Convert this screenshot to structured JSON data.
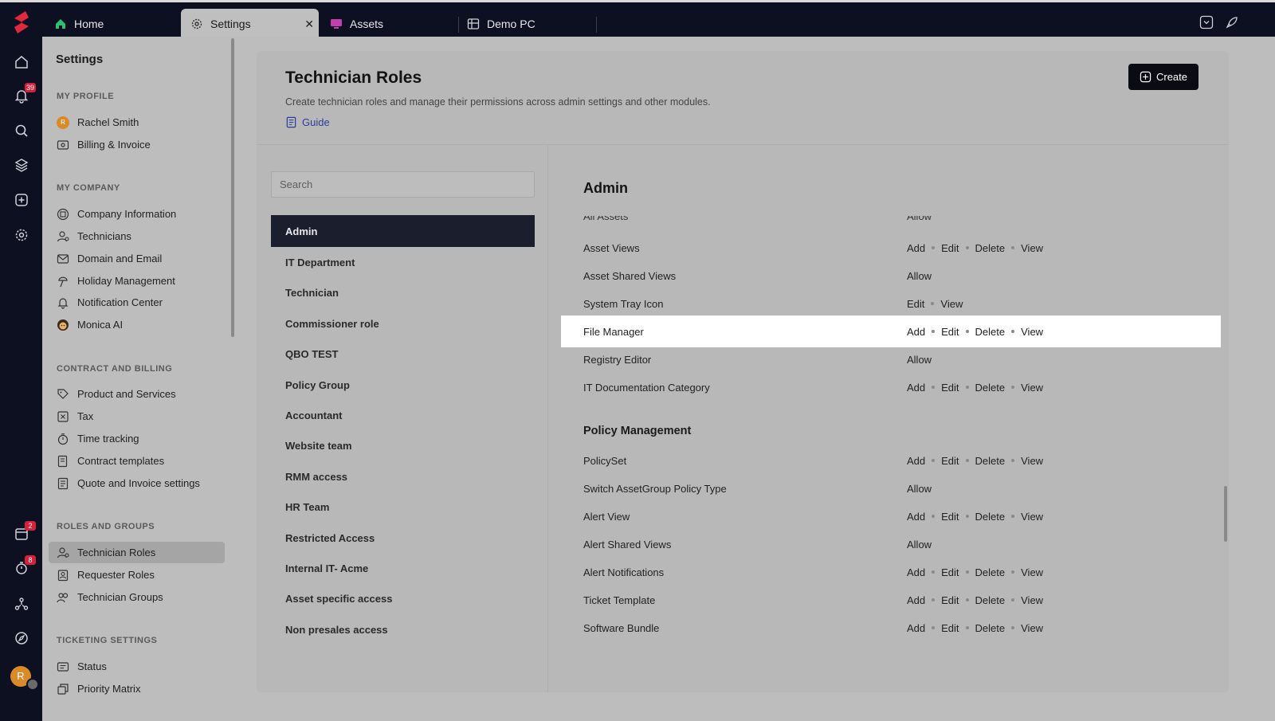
{
  "tabs": [
    {
      "label": "Home",
      "icon": "home-icon"
    },
    {
      "label": "Settings",
      "icon": "gear-icon",
      "active": true
    },
    {
      "label": "Assets",
      "icon": "monitor-icon"
    },
    {
      "label": "Demo PC",
      "icon": "windows-icon"
    }
  ],
  "rail": {
    "notifications_badge": "39",
    "calendar_badge": "2",
    "timer_badge": "8",
    "avatar_letter": "R"
  },
  "sidebar": {
    "title": "Settings",
    "sections": [
      {
        "label": "MY PROFILE",
        "items": [
          {
            "label": "Rachel Smith",
            "icon": "avatar-icon",
            "avatar": "R"
          },
          {
            "label": "Billing & Invoice",
            "icon": "billing-icon"
          }
        ]
      },
      {
        "label": "MY COMPANY",
        "items": [
          {
            "label": "Company Information",
            "icon": "company-icon"
          },
          {
            "label": "Technicians",
            "icon": "technician-icon"
          },
          {
            "label": "Domain and Email",
            "icon": "mail-icon"
          },
          {
            "label": "Holiday Management",
            "icon": "holiday-icon"
          },
          {
            "label": "Notification Center",
            "icon": "bell-icon"
          },
          {
            "label": "Monica AI",
            "icon": "monica-icon"
          }
        ]
      },
      {
        "label": "CONTRACT AND BILLING",
        "items": [
          {
            "label": "Product and Services",
            "icon": "product-icon"
          },
          {
            "label": "Tax",
            "icon": "tax-icon"
          },
          {
            "label": "Time tracking",
            "icon": "timer-icon"
          },
          {
            "label": "Contract templates",
            "icon": "contract-icon"
          },
          {
            "label": "Quote and Invoice settings",
            "icon": "invoice-icon"
          }
        ]
      },
      {
        "label": "ROLES AND GROUPS",
        "items": [
          {
            "label": "Technician Roles",
            "icon": "technician-role-icon",
            "active": true
          },
          {
            "label": "Requester Roles",
            "icon": "requester-icon"
          },
          {
            "label": "Technician Groups",
            "icon": "group-icon"
          }
        ]
      },
      {
        "label": "TICKETING SETTINGS",
        "items": [
          {
            "label": "Status",
            "icon": "status-icon"
          },
          {
            "label": "Priority Matrix",
            "icon": "matrix-icon"
          }
        ]
      }
    ]
  },
  "header": {
    "title": "Technician Roles",
    "description": "Create technician roles and manage their permissions across admin settings and other modules.",
    "guide_label": "Guide",
    "create_label": "Create"
  },
  "roles": {
    "search_placeholder": "Search",
    "items": [
      {
        "label": "Admin",
        "active": true
      },
      {
        "label": "IT Department"
      },
      {
        "label": "Technician"
      },
      {
        "label": "Commissioner role"
      },
      {
        "label": "QBO TEST"
      },
      {
        "label": "Policy Group"
      },
      {
        "label": "Accountant"
      },
      {
        "label": "Website team"
      },
      {
        "label": "RMM access"
      },
      {
        "label": "HR Team"
      },
      {
        "label": "Restricted Access"
      },
      {
        "label": "Internal IT- Acme"
      },
      {
        "label": "Asset specific access"
      },
      {
        "label": "Non presales access"
      }
    ]
  },
  "permissions": {
    "heading": "Admin",
    "cut_row": {
      "name": "All Assets",
      "value": "Allow"
    },
    "asset_rows": [
      {
        "name": "Asset Views",
        "values": [
          "Add",
          "Edit",
          "Delete",
          "View"
        ]
      },
      {
        "name": "Asset Shared Views",
        "values": [
          "Allow"
        ]
      },
      {
        "name": "System Tray Icon",
        "values": [
          "Edit",
          "View"
        ]
      },
      {
        "name": "File Manager",
        "values": [
          "Add",
          "Edit",
          "Delete",
          "View"
        ],
        "highlight": true
      },
      {
        "name": "Registry Editor",
        "values": [
          "Allow"
        ]
      },
      {
        "name": "IT Documentation Category",
        "values": [
          "Add",
          "Edit",
          "Delete",
          "View"
        ]
      }
    ],
    "group_label": "Policy Management",
    "policy_rows": [
      {
        "name": "PolicySet",
        "values": [
          "Add",
          "Edit",
          "Delete",
          "View"
        ]
      },
      {
        "name": "Switch AssetGroup Policy Type",
        "values": [
          "Allow"
        ]
      },
      {
        "name": "Alert View",
        "values": [
          "Add",
          "Edit",
          "Delete",
          "View"
        ]
      },
      {
        "name": "Alert Shared Views",
        "values": [
          "Allow"
        ]
      },
      {
        "name": "Alert Notifications",
        "values": [
          "Add",
          "Edit",
          "Delete",
          "View"
        ]
      },
      {
        "name": "Ticket Template",
        "values": [
          "Add",
          "Edit",
          "Delete",
          "View"
        ]
      },
      {
        "name": "Software Bundle",
        "values": [
          "Add",
          "Edit",
          "Delete",
          "View"
        ]
      }
    ]
  },
  "colors": {
    "rail_bg": "#0d1021",
    "accent_red": "#d6203a",
    "active_role_bg": "#1b1e2c",
    "highlight_row": "#ffffff",
    "link_blue": "#2b3d9a"
  }
}
